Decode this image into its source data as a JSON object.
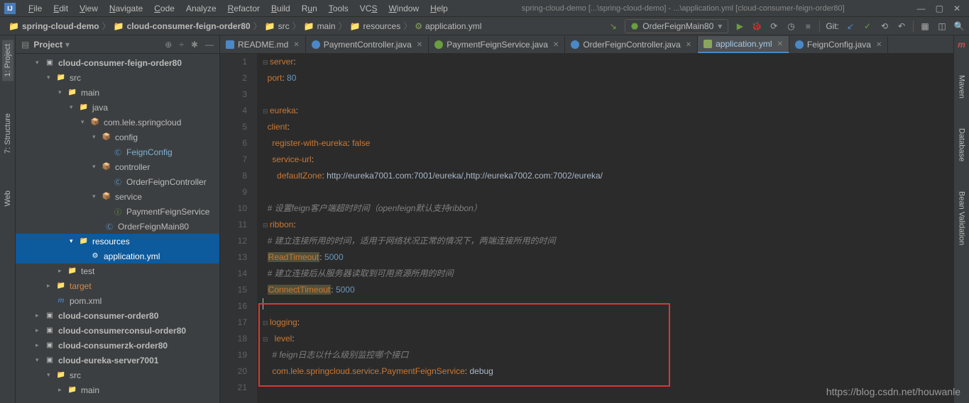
{
  "window": {
    "title": "spring-cloud-demo [...\\spring-cloud-demo] - ...\\application.yml [cloud-consumer-feign-order80]"
  },
  "menu": {
    "file": "File",
    "edit": "Edit",
    "view": "View",
    "navigate": "Navigate",
    "code": "Code",
    "analyze": "Analyze",
    "refactor": "Refactor",
    "build": "Build",
    "run": "Run",
    "tools": "Tools",
    "vcs": "VCS",
    "window": "Window",
    "help": "Help"
  },
  "breadcrumb": {
    "p0": "spring-cloud-demo",
    "p1": "cloud-consumer-feign-order80",
    "p2": "src",
    "p3": "main",
    "p4": "resources",
    "p5": "application.yml"
  },
  "runconfig": {
    "name": "OrderFeignMain80"
  },
  "git": {
    "label": "Git:"
  },
  "sidepanel": {
    "title": "Project"
  },
  "left_tabs": {
    "project": "1: Project",
    "structure": "7: Structure",
    "web": "Web"
  },
  "right_tabs": {
    "maven": "Maven",
    "database": "Database",
    "bean": "Bean Validation"
  },
  "tree": {
    "n0": "cloud-consumer-feign-order80",
    "n1": "src",
    "n2": "main",
    "n3": "java",
    "n4": "com.lele.springcloud",
    "n5": "config",
    "n6": "FeignConfig",
    "n7": "controller",
    "n8": "OrderFeignController",
    "n9": "service",
    "n10": "PaymentFeignService",
    "n11": "OrderFeignMain80",
    "n12": "resources",
    "n13": "application.yml",
    "n14": "test",
    "n15": "target",
    "n16": "pom.xml",
    "n17": "cloud-consumer-order80",
    "n18": "cloud-consumerconsul-order80",
    "n19": "cloud-consumerzk-order80",
    "n20": "cloud-eureka-server7001",
    "n21": "src",
    "n22": "main"
  },
  "tabs": {
    "t0": "README.md",
    "t1": "PaymentController.java",
    "t2": "PaymentFeignService.java",
    "t3": "OrderFeignController.java",
    "t4": "application.yml",
    "t5": "FeignConfig.java"
  },
  "code": {
    "l1a": "server",
    "l1b": ":",
    "l2a": "port",
    "l2b": ": ",
    "l2c": "80",
    "l4a": "eureka",
    "l4b": ":",
    "l5a": "client",
    "l5b": ":",
    "l6a": "register-with-eureka",
    "l6b": ": ",
    "l6c": "false",
    "l7a": "service-url",
    "l7b": ":",
    "l8a": "defaultZone",
    "l8b": ": ",
    "l8c": "http://eureka7001.com:7001/eureka/,http://eureka7002.com:7002/eureka/",
    "l10": "# 设置feign客户端超时时间（openfeign默认支持ribbon）",
    "l11a": "ribbon",
    "l11b": ":",
    "l12": "# 建立连接所用的时间，适用于网络状况正常的情况下，两端连接所用的时间",
    "l13a": "ReadTimeout",
    "l13b": ": ",
    "l13c": "5000",
    "l14": "# 建立连接后从服务器读取到可用资源所用的时间",
    "l15a": "ConnectTimeout",
    "l15b": ": ",
    "l15c": "5000",
    "l17a": "logging",
    "l17b": ":",
    "l18a": "level",
    "l18b": ":",
    "l19": "# feign日志以什么级别监控哪个接口",
    "l20a": "com.lele.springcloud.service.PaymentFeignService",
    "l20b": ": ",
    "l20c": "debug"
  },
  "watermark": "https://blog.csdn.net/houwanle"
}
